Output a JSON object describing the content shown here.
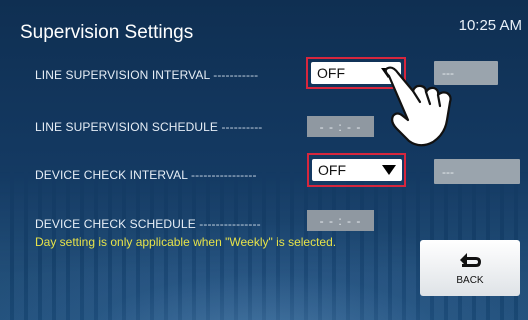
{
  "header": {
    "title": "Supervision Settings",
    "time": "10:25 AM"
  },
  "rows": [
    {
      "label": "LINE SUPERVISION INTERVAL",
      "leader": "-----------",
      "control": "OFF",
      "extra": "---"
    },
    {
      "label": "LINE SUPERVISION SCHEDULE",
      "leader": "----------",
      "value": "- - : - -"
    },
    {
      "label": "DEVICE CHECK INTERVAL",
      "leader": "----------------",
      "control": "OFF",
      "extra": "---"
    },
    {
      "label": "DEVICE CHECK SCHEDULE",
      "leader": "---------------",
      "value": "- - : - -"
    }
  ],
  "note": "Day setting is only applicable when \"Weekly\" is selected.",
  "back_button": {
    "label": "BACK",
    "icon": "back-arrow-icon"
  },
  "colors": {
    "background": "#143a63",
    "highlight": "#d7263d",
    "note": "#e6e24a",
    "disabled": "#9aa4ad"
  }
}
